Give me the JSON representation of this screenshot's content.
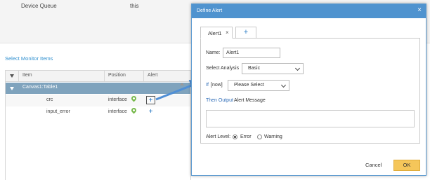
{
  "background": {
    "device_queue_label": "Device Queue",
    "device_queue_value": "this",
    "section_title": "Select Monitor Items",
    "grid": {
      "headers": [
        "Item",
        "Position",
        "Alert"
      ],
      "group_label": "Canvas1:Table1",
      "rows": [
        {
          "name": "crc",
          "position": "interface",
          "alert_icon": "+"
        },
        {
          "name": "input_error",
          "position": "interface",
          "alert_icon": "+"
        }
      ]
    }
  },
  "dialog": {
    "title": "Define Alert",
    "close_icon": "×",
    "tabs": [
      {
        "label": "Alert1",
        "close": "×"
      }
    ],
    "add_tab_icon": "+",
    "name_label": "Name:",
    "name_value": "Alert1",
    "analysis_label": "Select Analysis",
    "analysis_value": "Basic",
    "if_label": "If",
    "if_scope": "[now]",
    "condition_value": "Please Select",
    "then_label": "Then Output",
    "alert_message_label": "Alert Message",
    "alert_level_label": "Alert Level:",
    "level_options": [
      "Error",
      "Warning"
    ],
    "selected_level": "Error",
    "cancel_label": "Cancel",
    "ok_label": "OK"
  },
  "colors": {
    "dialog_header": "#4f93cf",
    "link_blue": "#2f6db8",
    "ok_button": "#f5c65a",
    "group_row": "#7fa3bd"
  }
}
